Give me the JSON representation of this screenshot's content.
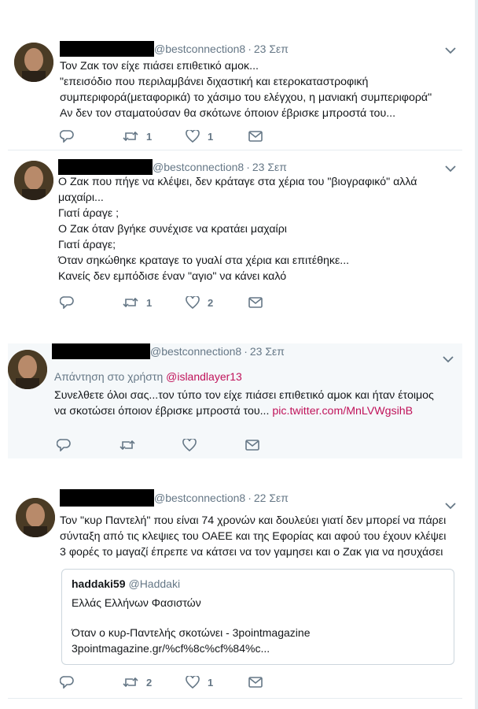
{
  "tweets": [
    {
      "handle": "@bestconnection8",
      "date": "23 Σεπ",
      "lines": [
        "Τον Ζακ τον είχε πιάσει επιθετικό αμοκ...",
        "\"επεισόδιο που περιλαμβάνει διχαστική και ετεροκαταστροφική",
        "συμπεριφορά(μεταφορικά) το χάσιμο του ελέγχου, η μανιακή συμπεριφορά\"",
        "Αν δεν τον σταματούσαν θα σκότωνε όποιον έβρισκε μπροστά του..."
      ],
      "retweets": "1",
      "likes": "1"
    },
    {
      "handle": "@bestconnection8",
      "date": "23 Σεπ",
      "lines": [
        "Ο Ζακ που πήγε να κλέψει,  δεν κράταγε στα χέρια του \"βιογραφικό\" αλλά",
        "μαχαίρι...",
        "Γιατί άραγε ;",
        "Ο Ζακ όταν βγήκε συνέχισε να κρατάει μαχαίρι",
        "Γιατί άραγε;",
        "Όταν σηκώθηκε κραταγε το γυαλί στα χέρια και επιτέθηκε...",
        "Κανείς δεν εμπόδισε έναν \"αγιο\" να κάνει καλό"
      ],
      "retweets": "1",
      "likes": "2"
    },
    {
      "handle": "@bestconnection8",
      "date": "23 Σεπ",
      "reply_prefix": "Απάντηση στο χρήστη ",
      "reply_user": "@islandlayer13",
      "line1": "Συνελθετε όλοι σας...τον τύπο τον είχε πιάσει επιθετικό αμοκ και ήταν έτοιμος",
      "line2": "να σκοτώσει όποιον έβρισκε μπροστά του... ",
      "link": "pic.twitter.com/MnLVWgsihB",
      "retweets": "",
      "likes": ""
    },
    {
      "handle": "@bestconnection8",
      "date": "22 Σεπ",
      "lines": [
        "Τον \"κυρ Παντελή\" που είναι 74 χρονών και δουλεύει γιατί δεν μπορεί να πάρει",
        "σύνταξη από τις κλεψιες του ΟΑΕΕ και της Εφορίας και αφού του έχουν κλέψει",
        "3 φορές το μαγαζί έπρεπε να κάτσει να τον γαμησει και ο Ζακ για να ησυχάσει"
      ],
      "quote": {
        "name": "haddaki59",
        "handle": "@Haddaki",
        "line1": "Ελλάς Ελλήνων Φασιστών",
        "line2": "Όταν ο κυρ-Παντελής σκοτώνει - 3pointmagazine",
        "line3": "3pointmagazine.gr/%cf%8c%cf%84%c..."
      },
      "retweets": "2",
      "likes": "1"
    }
  ]
}
